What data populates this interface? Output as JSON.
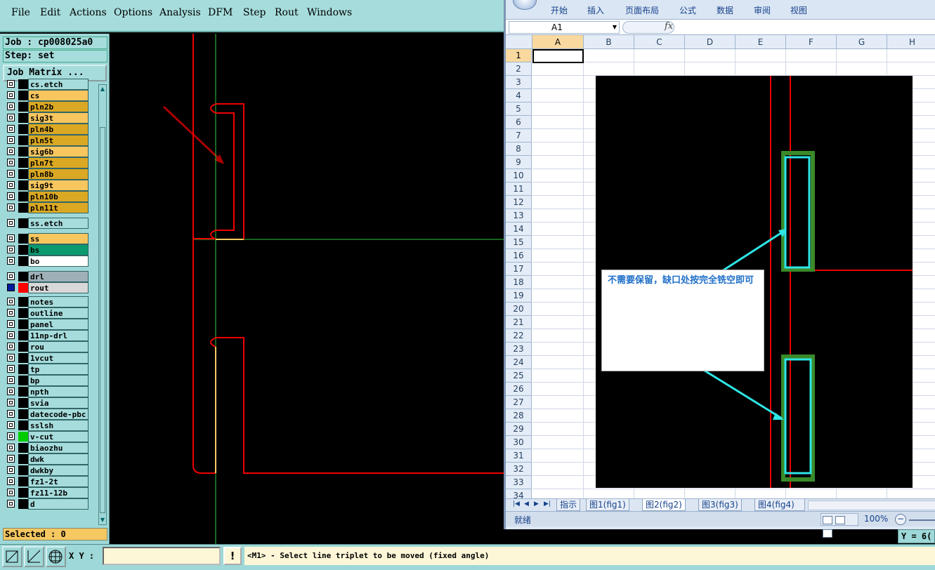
{
  "genesis": {
    "menu": [
      "File",
      "Edit",
      "Actions",
      "Options",
      "Analysis",
      "DFM",
      "Step",
      "Rout",
      "Windows"
    ],
    "job_label": "Job : cp008025a0",
    "step_label": "Step: set",
    "job_matrix_button": "Job Matrix ...",
    "layers": [
      {
        "name": "cs.etch",
        "color": "#a6dcdc",
        "swatch": "#000000"
      },
      {
        "name": "cs",
        "color": "#f7c65e",
        "swatch": "#000000"
      },
      {
        "name": "pln2b",
        "color": "#dba823",
        "swatch": "#000000"
      },
      {
        "name": "sig3t",
        "color": "#f7c65e",
        "swatch": "#000000"
      },
      {
        "name": "pln4b",
        "color": "#dba823",
        "swatch": "#000000"
      },
      {
        "name": "pln5t",
        "color": "#dba823",
        "swatch": "#000000"
      },
      {
        "name": "sig6b",
        "color": "#f7c65e",
        "swatch": "#000000"
      },
      {
        "name": "pln7t",
        "color": "#dba823",
        "swatch": "#000000"
      },
      {
        "name": "pln8b",
        "color": "#dba823",
        "swatch": "#000000"
      },
      {
        "name": "sig9t",
        "color": "#f7c65e",
        "swatch": "#000000"
      },
      {
        "name": "pln10b",
        "color": "#dba823",
        "swatch": "#000000"
      },
      {
        "name": "pln11t",
        "color": "#dba823",
        "swatch": "#000000"
      },
      {
        "name": "ss.etch",
        "color": "#a6dcdc",
        "swatch": "#000000"
      },
      {
        "name": "ss",
        "color": "#f7c65e",
        "swatch": "#000000"
      },
      {
        "name": "bs",
        "color": "#0b9b6e",
        "swatch": "#000000"
      },
      {
        "name": "bo",
        "color": "#ffffff",
        "swatch": "#000000"
      },
      {
        "name": "drl",
        "color": "#9fb0b8",
        "swatch": "#000000"
      },
      {
        "name": "rout",
        "color": "#d8d8d8",
        "swatch": "#ff0000",
        "active": true
      },
      {
        "name": "notes",
        "color": "#a6dcdc",
        "swatch": "#000000"
      },
      {
        "name": "outline",
        "color": "#a6dcdc",
        "swatch": "#000000"
      },
      {
        "name": "panel",
        "color": "#a6dcdc",
        "swatch": "#000000"
      },
      {
        "name": "11np-drl",
        "color": "#a6dcdc",
        "swatch": "#000000"
      },
      {
        "name": "rou",
        "color": "#a6dcdc",
        "swatch": "#000000"
      },
      {
        "name": "1vcut",
        "color": "#a6dcdc",
        "swatch": "#000000"
      },
      {
        "name": "tp",
        "color": "#a6dcdc",
        "swatch": "#000000"
      },
      {
        "name": "bp",
        "color": "#a6dcdc",
        "swatch": "#000000"
      },
      {
        "name": "npth",
        "color": "#a6dcdc",
        "swatch": "#000000"
      },
      {
        "name": "svia",
        "color": "#a6dcdc",
        "swatch": "#000000"
      },
      {
        "name": "datecode-pbc",
        "color": "#a6dcdc",
        "swatch": "#000000"
      },
      {
        "name": "sslsh",
        "color": "#a6dcdc",
        "swatch": "#000000"
      },
      {
        "name": "v-cut",
        "color": "#a6dcdc",
        "swatch": "#00cc00"
      },
      {
        "name": "biaozhu",
        "color": "#a6dcdc",
        "swatch": "#000000"
      },
      {
        "name": "dwk",
        "color": "#a6dcdc",
        "swatch": "#000000"
      },
      {
        "name": "dwkby",
        "color": "#a6dcdc",
        "swatch": "#000000"
      },
      {
        "name": "fz1-2t",
        "color": "#a6dcdc",
        "swatch": "#000000"
      },
      {
        "name": "fz11-12b",
        "color": "#a6dcdc",
        "swatch": "#000000"
      },
      {
        "name": "d",
        "color": "#a6dcdc",
        "swatch": "#000000"
      }
    ],
    "selected_label": "Selected : 0",
    "xy_label": "X Y :",
    "xy_value": "",
    "warn_button": "!",
    "prompt": "<M1> - Select line triplet to be moved (fixed angle)",
    "xy_readout": "Y = 6("
  },
  "excel": {
    "tabs": [
      "开始",
      "插入",
      "页面布局",
      "公式",
      "数据",
      "审阅",
      "视图"
    ],
    "name_box": "A1",
    "fx": "fx",
    "columns": [
      "A",
      "B",
      "C",
      "D",
      "E",
      "F",
      "G",
      "H"
    ],
    "rows": [
      "1",
      "2",
      "3",
      "4",
      "5",
      "6",
      "7",
      "8",
      "9",
      "10",
      "11",
      "12",
      "13",
      "14",
      "15",
      "16",
      "17",
      "18",
      "19",
      "20",
      "21",
      "22",
      "23",
      "24",
      "25",
      "26",
      "27",
      "28",
      "29",
      "30",
      "31",
      "32",
      "33",
      "34"
    ],
    "callout_text": "不需要保留，缺口处按完全铣空即可",
    "sheets": [
      "指示",
      "图1(fig1)",
      "图2(fig2)",
      "图3(fig3)",
      "图4(fig4)"
    ],
    "active_sheet": "图2(fig2)",
    "status_ready": "就绪",
    "zoom": "100%"
  }
}
